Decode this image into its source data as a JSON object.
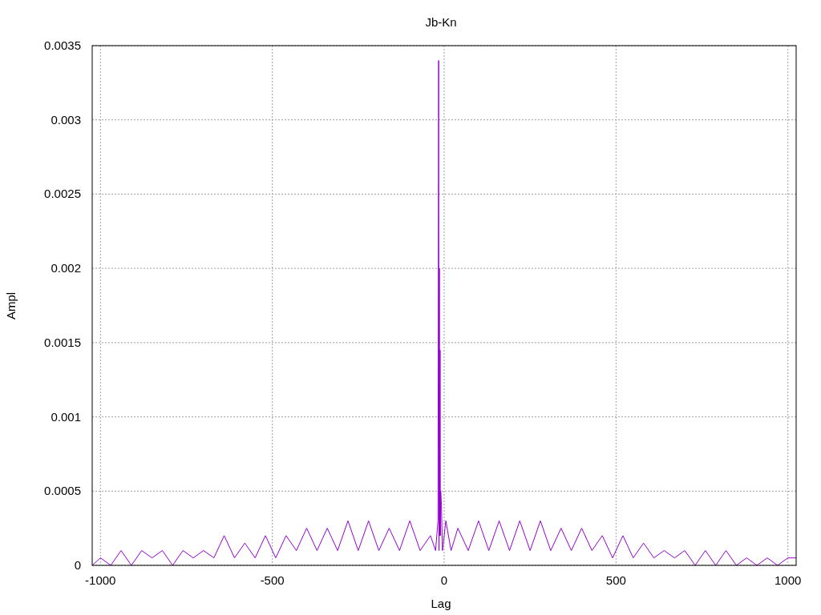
{
  "chart_data": {
    "type": "line",
    "title": "Jb-Kn",
    "xlabel": "Lag",
    "ylabel": "Ampl",
    "xlim": [
      -1024,
      1024
    ],
    "ylim": [
      0,
      0.0035
    ],
    "xticks": [
      -1000,
      -500,
      0,
      500,
      1000
    ],
    "yticks": [
      {
        "value": 0,
        "label": "0"
      },
      {
        "value": 0.0005,
        "label": "0.0005"
      },
      {
        "value": 0.001,
        "label": "0.001"
      },
      {
        "value": 0.0015,
        "label": "0.0015"
      },
      {
        "value": 0.002,
        "label": "0.002"
      },
      {
        "value": 0.0025,
        "label": "0.0025"
      },
      {
        "value": 0.003,
        "label": "0.003"
      },
      {
        "value": 0.0035,
        "label": "0.0035"
      }
    ],
    "x": [
      -1024,
      -1000,
      -970,
      -940,
      -910,
      -880,
      -850,
      -820,
      -790,
      -760,
      -730,
      -700,
      -670,
      -640,
      -610,
      -580,
      -550,
      -520,
      -490,
      -460,
      -430,
      -400,
      -370,
      -340,
      -310,
      -280,
      -250,
      -220,
      -190,
      -160,
      -130,
      -100,
      -70,
      -40,
      -25,
      -18,
      -16,
      -15,
      -14,
      -13,
      -12,
      -11,
      -10,
      -8,
      -5,
      5,
      20,
      40,
      70,
      100,
      130,
      160,
      190,
      220,
      250,
      280,
      310,
      340,
      370,
      400,
      430,
      460,
      490,
      520,
      550,
      580,
      610,
      640,
      670,
      700,
      730,
      760,
      790,
      820,
      850,
      880,
      910,
      940,
      970,
      1000,
      1024
    ],
    "series": [
      {
        "color": "#9400d3",
        "values": [
          0,
          5e-05,
          0,
          0.0001,
          0,
          0.0001,
          5e-05,
          0.0001,
          0,
          0.0001,
          5e-05,
          0.0001,
          5e-05,
          0.0002,
          5e-05,
          0.00015,
          5e-05,
          0.0002,
          5e-05,
          0.0002,
          0.0001,
          0.00025,
          0.0001,
          0.00025,
          0.0001,
          0.0003,
          0.0001,
          0.0003,
          0.0001,
          0.00025,
          0.0001,
          0.0003,
          0.0001,
          0.0002,
          0.0001,
          0.0003,
          0.0034,
          0.0001,
          0.002,
          0.0002,
          0.00145,
          0.0002,
          0.0005,
          0.0004,
          0.0001,
          0.0003,
          0.0001,
          0.00025,
          0.0001,
          0.0003,
          0.0001,
          0.0003,
          0.0001,
          0.0003,
          0.0001,
          0.0003,
          0.0001,
          0.00025,
          0.0001,
          0.00025,
          0.0001,
          0.0002,
          5e-05,
          0.0002,
          5e-05,
          0.00015,
          5e-05,
          0.0001,
          5e-05,
          0.0001,
          0,
          0.0001,
          0,
          0.0001,
          0,
          5e-05,
          0,
          5e-05,
          0,
          5e-05,
          5e-05
        ]
      }
    ],
    "grid": true
  }
}
